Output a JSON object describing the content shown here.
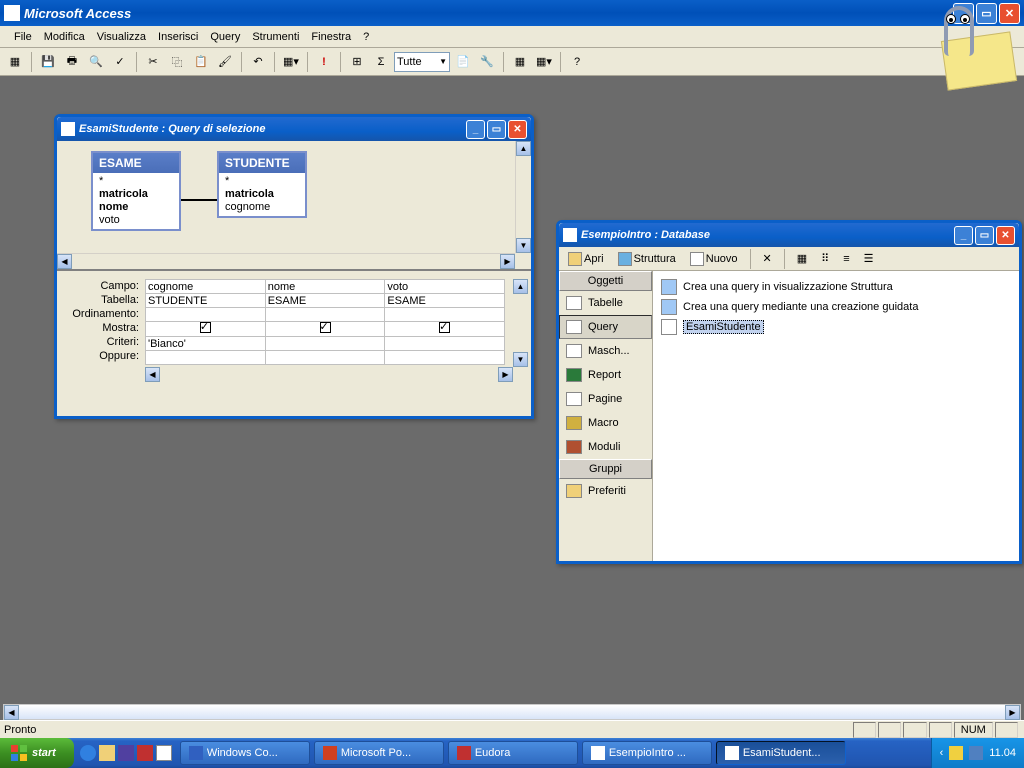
{
  "app": {
    "title": "Microsoft Access"
  },
  "menu": [
    "File",
    "Modifica",
    "Visualizza",
    "Inserisci",
    "Query",
    "Strumenti",
    "Finestra",
    "?"
  ],
  "menu_underlines": [
    "F",
    "M",
    "V",
    "I",
    "Q",
    "S",
    "n",
    "?"
  ],
  "toolbar_combo": "Tutte",
  "query_window": {
    "title": "EsamiStudente : Query di selezione",
    "tables": [
      {
        "name": "ESAME",
        "fields": [
          "*",
          "matricola",
          "nome",
          "voto"
        ],
        "bold": [
          false,
          true,
          true,
          false
        ]
      },
      {
        "name": "STUDENTE",
        "fields": [
          "*",
          "matricola",
          "cognome"
        ],
        "bold": [
          false,
          true,
          false
        ]
      }
    ],
    "grid_labels": [
      "Campo:",
      "Tabella:",
      "Ordinamento:",
      "Mostra:",
      "Criteri:",
      "Oppure:"
    ],
    "grid": {
      "campo": [
        "cognome",
        "nome",
        "voto"
      ],
      "tabella": [
        "STUDENTE",
        "ESAME",
        "ESAME"
      ],
      "ordinamento": [
        "",
        "",
        ""
      ],
      "mostra": [
        true,
        true,
        true
      ],
      "criteri": [
        "'Bianco'",
        "",
        ""
      ],
      "oppure": [
        "",
        "",
        ""
      ]
    }
  },
  "db_window": {
    "title": "EsempioIntro : Database",
    "toolbar": [
      "Apri",
      "Struttura",
      "Nuovo"
    ],
    "sidebar": {
      "cat1": "Oggetti",
      "items": [
        "Tabelle",
        "Query",
        "Masch...",
        "Report",
        "Pagine",
        "Macro",
        "Moduli"
      ],
      "selected": "Query",
      "cat2": "Gruppi",
      "groups": [
        "Preferiti"
      ]
    },
    "content": [
      "Crea una query in visualizzazione Struttura",
      "Crea una query mediante una creazione guidata",
      "EsamiStudente"
    ],
    "content_selected": 2
  },
  "status": {
    "left": "Pronto",
    "right": "NUM"
  },
  "taskbar": {
    "start": "start",
    "tasks": [
      "Windows Co...",
      "Microsoft Po...",
      "Eudora",
      "EsempioIntro ...",
      "EsamiStudent..."
    ],
    "active_task": 4,
    "clock": "11.04"
  }
}
